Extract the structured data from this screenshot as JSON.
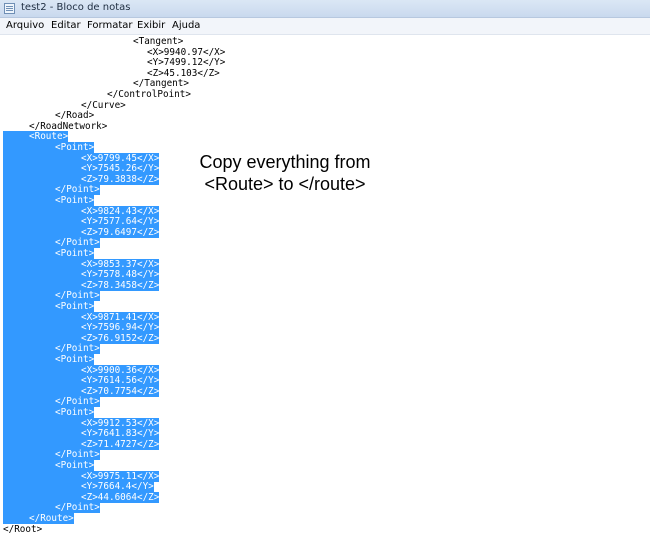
{
  "window": {
    "title": "test2 - Bloco de notas",
    "app_icon": "notepad-icon"
  },
  "menu": [
    "Arquivo",
    "Editar",
    "Formatar",
    "Exibir",
    "Ajuda"
  ],
  "editor": {
    "lines": [
      "<Tangent>",
      "<X>9940.97</X>",
      "<Y>7499.12</Y>",
      "<Z>45.103</Z>",
      "</Tangent>",
      "</ControlPoint>",
      "</Curve>",
      "</Road>",
      "</RoadNetwork>",
      "<Route>",
      "<Point>",
      "<X>9799.45</X>",
      "<Y>7545.26</Y>",
      "<Z>79.3838</Z>",
      "</Point>",
      "<Point>",
      "<X>9824.43</X>",
      "<Y>7577.64</Y>",
      "<Z>79.6497</Z>",
      "</Point>",
      "<Point>",
      "<X>9853.37</X>",
      "<Y>7578.48</Y>",
      "<Z>78.3458</Z>",
      "</Point>",
      "<Point>",
      "<X>9871.41</X>",
      "<Y>7596.94</Y>",
      "<Z>76.9152</Z>",
      "</Point>",
      "<Point>",
      "<X>9900.36</X>",
      "<Y>7614.56</Y>",
      "<Z>70.7754</Z>",
      "</Point>",
      "<Point>",
      "<X>9912.53</X>",
      "<Y>7641.83</Y>",
      "<Z>71.4727</Z>",
      "</Point>",
      "<Point>",
      "<X>9975.11</X>",
      "<Y>7664.4</Y>",
      "<Z>44.6064</Z>",
      "</Point>",
      "</Route>",
      "</Root>"
    ],
    "selection_color": "#3399ff"
  },
  "annotation": {
    "line1": "Copy everything from",
    "line2": "<Route> to </route>"
  }
}
